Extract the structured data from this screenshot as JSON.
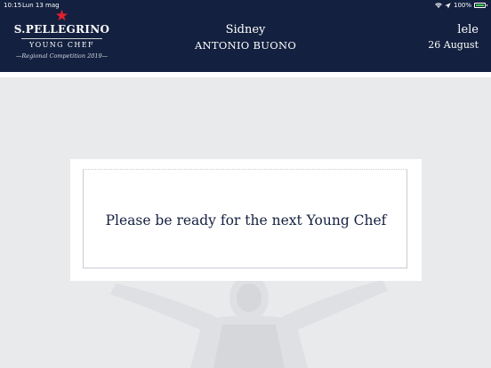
{
  "status_bar": {
    "time": "10:15",
    "date": "Lun 13 mag",
    "battery": "100%"
  },
  "logo": {
    "brand": "S.PELLEGRINO",
    "subtitle": "YOUNG CHEF",
    "competition": "Regional Competition 2019"
  },
  "header": {
    "city": "Sidney",
    "chef_name": "ANTONIO BUONO",
    "user": "lele",
    "date": "26 August"
  },
  "card": {
    "message": "Please be ready for the next Young Chef"
  },
  "colors": {
    "header_bg": "#13203f",
    "page_bg": "#e9eaec",
    "accent_star": "#e4202e",
    "battery": "#44d04d"
  }
}
